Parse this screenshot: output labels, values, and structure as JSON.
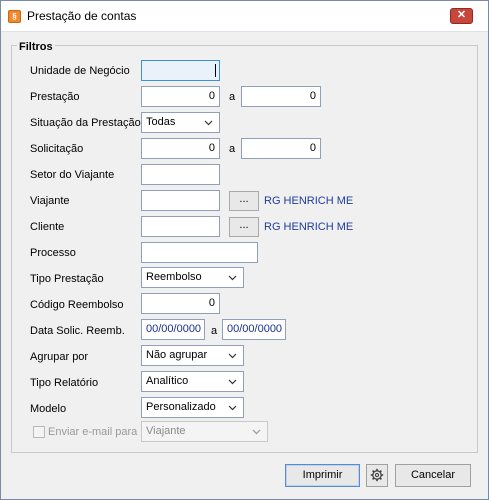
{
  "window": {
    "title": "Prestação de contas",
    "close_label": "✕",
    "app_icon": "§"
  },
  "group": {
    "title": "Filtros"
  },
  "fields": {
    "unidade_label": "Unidade de Negócio",
    "prestacao_label": "Prestação",
    "prestacao_from": "0",
    "prestacao_to": "0",
    "range_sep": "a",
    "situacao_label": "Situação da Prestação",
    "situacao_value": "Todas",
    "solicitacao_label": "Solicitação",
    "solicitacao_from": "0",
    "solicitacao_to": "0",
    "setor_label": "Setor do Viajante",
    "viajante_label": "Viajante",
    "viajante_link": "RG HENRICH ME",
    "cliente_label": "Cliente",
    "cliente_link": "RG HENRICH ME",
    "ellipsis": "...",
    "processo_label": "Processo",
    "tipo_prestacao_label": "Tipo Prestação",
    "tipo_prestacao_value": "Reembolso",
    "codigo_reembolso_label": "Código Reembolso",
    "codigo_reembolso_value": "0",
    "data_label": "Data Solic. Reemb.",
    "data_from": "00/00/0000",
    "data_to": "00/00/0000",
    "agrupar_label": "Agrupar por",
    "agrupar_value": "Não agrupar",
    "tipo_relatorio_label": "Tipo Relatório",
    "tipo_relatorio_value": "Analítico",
    "modelo_label": "Modelo",
    "modelo_value": "Personalizado",
    "email_label": "Enviar e-mail para",
    "email_value": "Viajante"
  },
  "buttons": {
    "print": "Imprimir",
    "cancel": "Cancelar",
    "settings_icon": "gear-icon"
  }
}
